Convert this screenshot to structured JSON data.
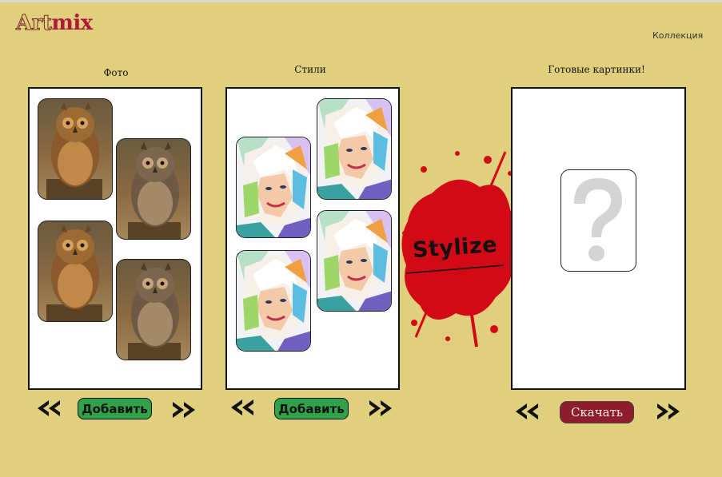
{
  "app": {
    "logo_part1": "Art",
    "logo_part2": "mix",
    "nav_collection": "Коллекция"
  },
  "columns": {
    "photos": {
      "title": "Фото",
      "add_label": "Добавить"
    },
    "styles": {
      "title": "Стили",
      "add_label": "Добавить"
    },
    "results": {
      "title": "Готовые картинки!",
      "download_label": "Скачать"
    }
  },
  "stylize": {
    "label": "Stylize"
  },
  "icons": {
    "prev": "double-chevron-left-icon",
    "next": "double-chevron-right-icon",
    "placeholder": "question-mark-icon"
  },
  "colors": {
    "background": "#e0cf7d",
    "add_button": "#2fa24a",
    "download_button": "#8e1d2e",
    "splash": "#d10a16",
    "logo_accent": "#b0183a"
  }
}
